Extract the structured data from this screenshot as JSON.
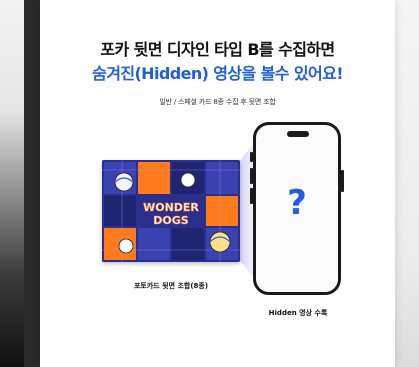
{
  "promo": {
    "headline_line1": "포카 뒷면 디자인 타입 B를 수집하면",
    "headline_line2": "숨겨진(Hidden) 영상을 볼수 있어요!",
    "subcaption": "일반 / 스페셜 카드 8종 수집 후 뒷면 조합",
    "card_caption": "포토카드 뒷면 조합(8종)",
    "phone_caption": "Hidden 영상 수록",
    "question_mark": "?",
    "card_text_line1": "WONDER",
    "card_text_line2": "DOGS"
  },
  "colors": {
    "accent_blue": "#1f5fe0",
    "card_navy": "#2a2f8f",
    "card_orange": "#ff7a1a",
    "beam_lavender": "#d8d2f3"
  },
  "icons": {
    "phone": "smartphone-outline",
    "card": "volleyball-photocard-back"
  }
}
